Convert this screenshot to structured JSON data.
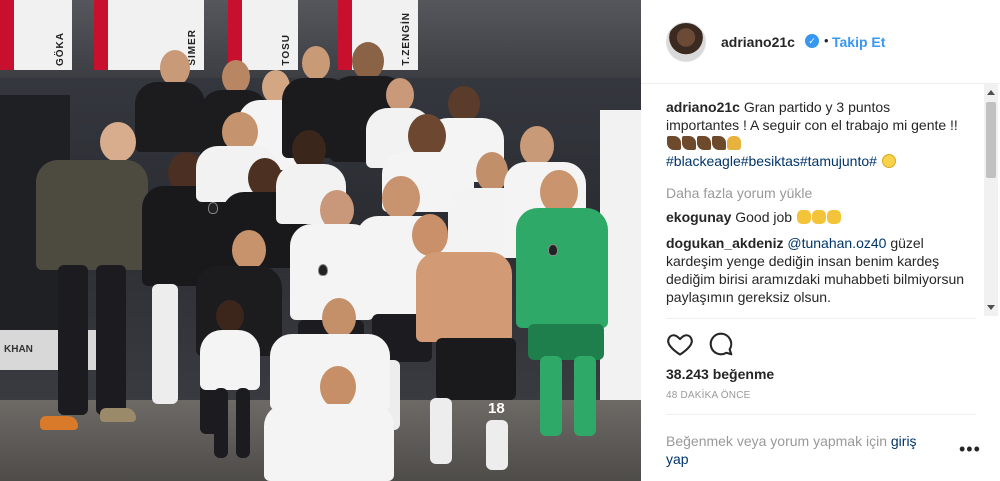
{
  "post": {
    "username": "adriano21c",
    "verified_icon": "verified-badge-icon",
    "separator": "•",
    "follow_label": "Takip Et",
    "caption_user": "adriano21c",
    "caption_text": "Gran partido y 3 puntos importantes ! A seguir con el trabajo mi gente !!",
    "hashtags": "#blackeagle#besiktas#tamujunto#",
    "load_more": "Daha fazla yorum yükle",
    "comments": [
      {
        "user": "ekogunay",
        "text": "Good job"
      },
      {
        "user": "dogukan_akdeniz",
        "mention": "@tunahan.oz40",
        "text": "güzel kardeşim yenge dediğin insan benim kardeş dediğim birisi aramızdaki muhabbeti bilmiyorsun paylaşımın gereksiz olsun."
      }
    ],
    "likes": "38.243 beğenme",
    "time": "48 DAKİKA ÖNCE",
    "login_prompt": "Beğenmek veya yorum yapmak için",
    "login_link": "giriş yap",
    "more_label": "•••",
    "icons": [
      "heart-icon",
      "comment-icon",
      "more-options-icon"
    ],
    "accent_color": "#3897f0",
    "link_color": "#003569"
  },
  "photo": {
    "poster_names": [
      "GÖKA",
      "SIMER",
      "TOSU",
      "T.ZENGİN"
    ],
    "jersey_number": "18",
    "sign_text": "KHAN"
  }
}
